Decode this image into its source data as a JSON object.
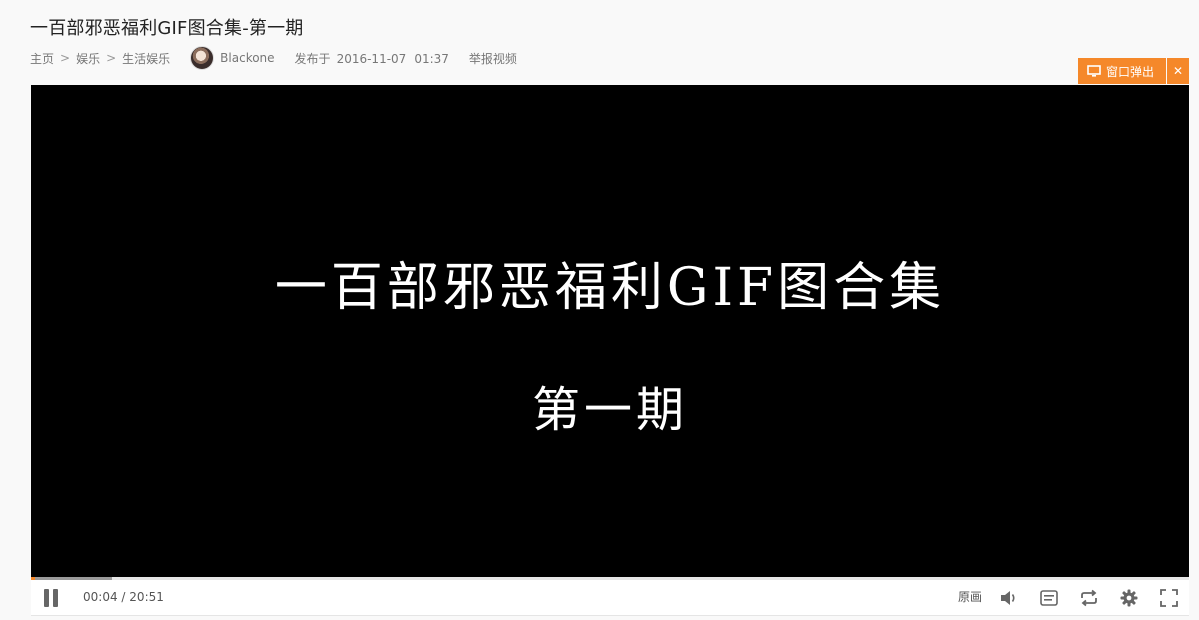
{
  "page": {
    "title": "一百部邪恶福利GIF图合集-第一期"
  },
  "breadcrumb": {
    "items": [
      "主页",
      "娱乐",
      "生活娱乐"
    ],
    "separator": ">"
  },
  "uploader": {
    "name": "Blackone"
  },
  "published": {
    "label": "发布于",
    "date": "2016-11-07",
    "time": "01:37"
  },
  "report_label": "举报视频",
  "popout": {
    "label": "窗口弹出",
    "close_symbol": "✕",
    "color": "#f5882a"
  },
  "video": {
    "title": "一百部邪恶福利GIF图合集",
    "subtitle": "第一期"
  },
  "player": {
    "current_time": "00:04",
    "duration": "20:51",
    "time_separator": "/",
    "played_fraction": 0.0032,
    "buffered_fraction": 0.07,
    "quality_label": "原画",
    "icons": [
      "pause-icon",
      "volume-icon",
      "danmaku-icon",
      "loop-icon",
      "settings-icon",
      "fullscreen-icon"
    ]
  }
}
